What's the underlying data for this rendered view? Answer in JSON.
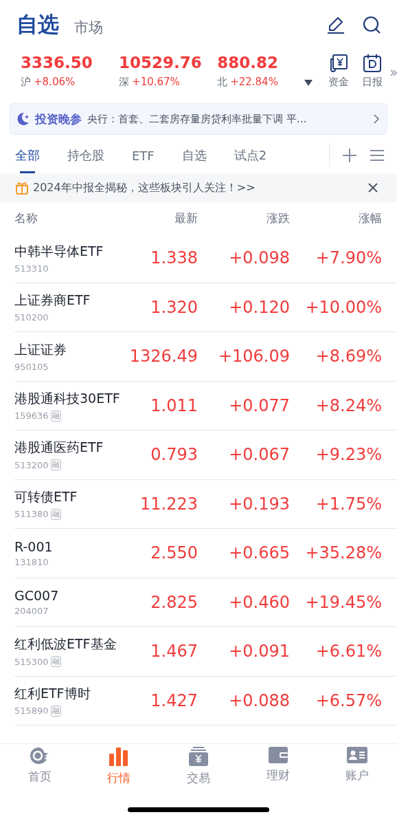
{
  "header": {
    "tabs": [
      {
        "label": "自选",
        "selected": true
      },
      {
        "label": "市场",
        "selected": false
      }
    ]
  },
  "indices": [
    {
      "value": "3336.50",
      "name": "沪",
      "change": "+8.06%"
    },
    {
      "value": "10529.76",
      "name": "深",
      "change": "+10.67%"
    },
    {
      "value": "880.82",
      "name": "北",
      "change": "+22.84%"
    }
  ],
  "shortcuts": [
    {
      "kind": "fund",
      "label": "资金"
    },
    {
      "kind": "daily",
      "label": "日报"
    }
  ],
  "news": {
    "brand": "投资晚参",
    "text": "央行：首套、二套房存量房贷利率批量下调 平…"
  },
  "tabs": [
    {
      "label": "全部",
      "selected": true
    },
    {
      "label": "持仓股",
      "selected": false
    },
    {
      "label": "ETF",
      "selected": false
    },
    {
      "label": "自选",
      "selected": false
    },
    {
      "label": "试点2",
      "selected": false
    }
  ],
  "promo": {
    "text": "2024年中报全揭秘，这些板块引人关注！>>"
  },
  "columns": [
    "名称",
    "最新",
    "涨跌",
    "涨幅"
  ],
  "rows": [
    {
      "name": "中韩半导体ETF",
      "code": "513310",
      "price": "1.338",
      "change": "+0.098",
      "pct": "+7.90%"
    },
    {
      "name": "上证券商ETF",
      "code": "510200",
      "price": "1.320",
      "change": "+0.120",
      "pct": "+10.00%"
    },
    {
      "name": "上证证券",
      "code": "950105",
      "price": "1326.49",
      "change": "+106.09",
      "pct": "+8.69%"
    },
    {
      "name": "港股通科技30ETF",
      "code": "159636",
      "badge": "融",
      "price": "1.011",
      "change": "+0.077",
      "pct": "+8.24%"
    },
    {
      "name": "港股通医药ETF",
      "code": "513200",
      "badge": "融",
      "price": "0.793",
      "change": "+0.067",
      "pct": "+9.23%"
    },
    {
      "name": "可转债ETF",
      "code": "511380",
      "badge": "融",
      "price": "11.223",
      "change": "+0.193",
      "pct": "+1.75%"
    },
    {
      "name": "R-001",
      "code": "131810",
      "price": "2.550",
      "change": "+0.665",
      "pct": "+35.28%"
    },
    {
      "name": "GC007",
      "code": "204007",
      "price": "2.825",
      "change": "+0.460",
      "pct": "+19.45%"
    },
    {
      "name": "红利低波ETF基金",
      "code": "515300",
      "badge": "融",
      "price": "1.467",
      "change": "+0.091",
      "pct": "+6.61%"
    },
    {
      "name": "红利ETF博时",
      "code": "515890",
      "badge": "融",
      "price": "1.427",
      "change": "+0.088",
      "pct": "+6.57%"
    }
  ],
  "nav": [
    {
      "kind": "home",
      "label": "首页",
      "selected": false
    },
    {
      "kind": "market",
      "label": "行情",
      "selected": true
    },
    {
      "kind": "trade",
      "label": "交易",
      "selected": false
    },
    {
      "kind": "wealth",
      "label": "理财",
      "selected": false
    },
    {
      "kind": "account",
      "label": "账户",
      "selected": false
    }
  ]
}
